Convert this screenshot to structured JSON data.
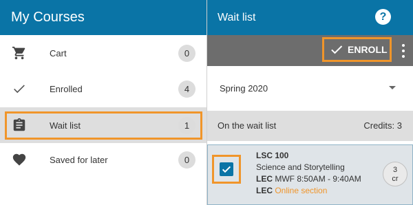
{
  "left_panel": {
    "title": "My Courses",
    "nav": [
      {
        "label": "Cart",
        "count": "0",
        "icon": "cart-icon"
      },
      {
        "label": "Enrolled",
        "count": "4",
        "icon": "check-icon"
      },
      {
        "label": "Wait list",
        "count": "1",
        "icon": "clipboard-icon",
        "selected": true
      },
      {
        "label": "Saved for later",
        "count": "0",
        "icon": "heart-icon"
      }
    ]
  },
  "right_panel": {
    "title": "Wait list",
    "help_symbol": "?",
    "enroll_label": "ENROLL",
    "term": {
      "value": "Spring 2020"
    },
    "section": {
      "title": "On the wait list",
      "credits": "Credits: 3"
    },
    "course": {
      "code": "LSC 100",
      "name": "Science and Storytelling",
      "meeting_type": "LEC",
      "meeting_time": "MWF 8:50AM - 9:40AM",
      "section_type": "LEC",
      "section_link": "Online section",
      "credit_value": "3",
      "credit_unit": "cr",
      "checked": true
    }
  },
  "colors": {
    "header_blue": "#0a74a6",
    "highlight_orange": "#f0952a",
    "toolbar_gray": "#6d6d6d"
  }
}
